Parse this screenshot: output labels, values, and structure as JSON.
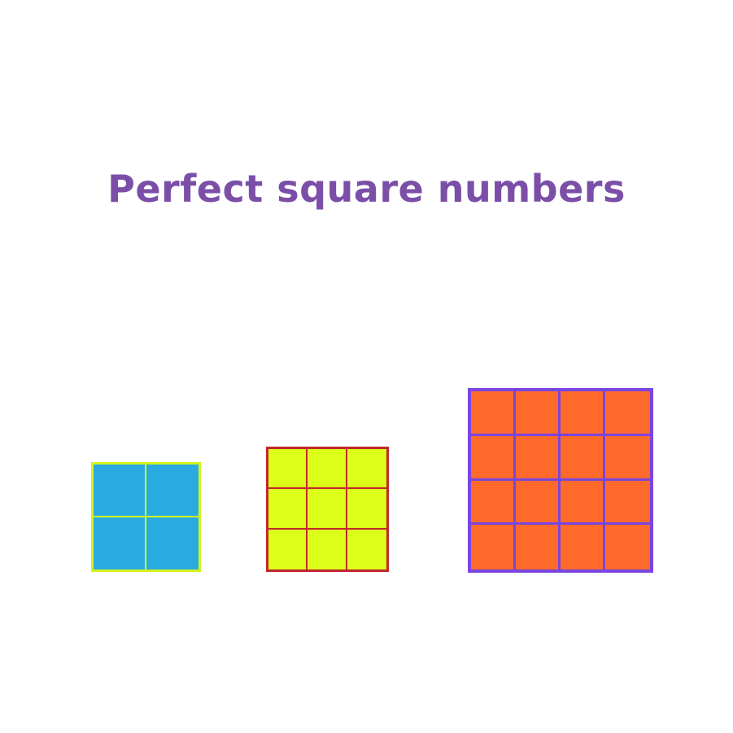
{
  "title": "Perfect square numbers",
  "colors": {
    "title": "#7b4fa8",
    "background": "#ffffff"
  },
  "squares": [
    {
      "side": 2,
      "fill": "#29abe2",
      "line": "#d4f21c"
    },
    {
      "side": 3,
      "fill": "#dbff19",
      "line": "#c1272d"
    },
    {
      "side": 4,
      "fill": "#ff6a2b",
      "line": "#7a45e0"
    }
  ]
}
